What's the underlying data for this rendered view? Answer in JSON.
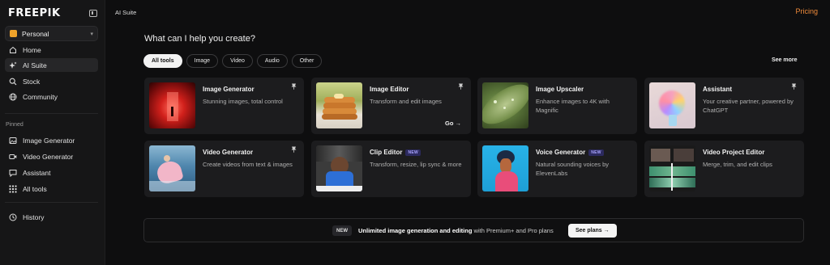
{
  "sidebar": {
    "logo": "FREEPIK",
    "workspace": "Personal",
    "nav": [
      {
        "label": "Home",
        "icon": "home-icon"
      },
      {
        "label": "AI Suite",
        "icon": "sparkle-icon"
      },
      {
        "label": "Stock",
        "icon": "search-icon"
      },
      {
        "label": "Community",
        "icon": "globe-icon"
      }
    ],
    "pinned_label": "Pinned",
    "pinned": [
      {
        "label": "Image Generator",
        "icon": "image-icon"
      },
      {
        "label": "Video Generator",
        "icon": "video-icon"
      },
      {
        "label": "Assistant",
        "icon": "chat-icon"
      },
      {
        "label": "All tools",
        "icon": "grid-icon"
      }
    ],
    "history": "History"
  },
  "topbar": {
    "breadcrumb": "AI Suite",
    "pricing": "Pricing"
  },
  "main": {
    "headline": "What can I help you create?",
    "filters": [
      "All tools",
      "Image",
      "Video",
      "Audio",
      "Other"
    ],
    "see_more": "See more",
    "tools": [
      {
        "title": "Image Generator",
        "desc": "Stunning images, total control",
        "badge": "",
        "pinned": true
      },
      {
        "title": "Image Editor",
        "desc": "Transform and edit images",
        "badge": "",
        "pinned": true,
        "action": "Go →"
      },
      {
        "title": "Image Upscaler",
        "desc": "Enhance images to 4K with Magnific",
        "badge": "",
        "pinned": false
      },
      {
        "title": "Assistant",
        "desc": "Your creative partner, powered by ChatGPT",
        "badge": "",
        "pinned": true
      },
      {
        "title": "Video Generator",
        "desc": "Create videos from text & images",
        "badge": "",
        "pinned": true
      },
      {
        "title": "Clip Editor",
        "desc": "Transform, resize, lip sync & more",
        "badge": "NEW",
        "pinned": false
      },
      {
        "title": "Voice Generator",
        "desc": "Natural sounding voices by ElevenLabs",
        "badge": "NEW",
        "pinned": false
      },
      {
        "title": "Video Project Editor",
        "desc": "Merge, trim, and edit clips",
        "badge": "",
        "pinned": false
      }
    ]
  },
  "banner": {
    "badge": "NEW",
    "bold": "Unlimited image generation and editing",
    "rest": " with Premium+ and Pro plans",
    "cta": "See plans →"
  },
  "colors": {
    "accent": "#ef8b3a",
    "workspace_badge": "#f0a32a",
    "new_badge_bg": "#2c2a5e",
    "new_badge_text": "#a9a4ff"
  }
}
